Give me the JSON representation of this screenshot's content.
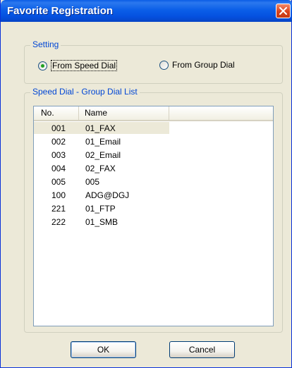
{
  "window": {
    "title": "Favorite Registration"
  },
  "setting": {
    "label": "Setting",
    "options": [
      {
        "label": "From Speed Dial",
        "selected": true
      },
      {
        "label": "From Group Dial",
        "selected": false
      }
    ]
  },
  "list": {
    "label": "Speed Dial - Group Dial List",
    "columns": [
      "No.",
      "Name"
    ],
    "rows": [
      {
        "no": "001",
        "name": "01_FAX"
      },
      {
        "no": "002",
        "name": "01_Email"
      },
      {
        "no": "003",
        "name": "02_Email"
      },
      {
        "no": "004",
        "name": "02_FAX"
      },
      {
        "no": "005",
        "name": "005"
      },
      {
        "no": "100",
        "name": "ADG@DGJ"
      },
      {
        "no": "221",
        "name": "01_FTP"
      },
      {
        "no": "222",
        "name": "01_SMB"
      }
    ],
    "selected_index": 0
  },
  "buttons": {
    "ok": "OK",
    "cancel": "Cancel"
  },
  "colors": {
    "title_bar": "#0551e0",
    "group_label": "#0046d5",
    "close_button": "#d9421c",
    "radio_dot": "#21a121"
  }
}
